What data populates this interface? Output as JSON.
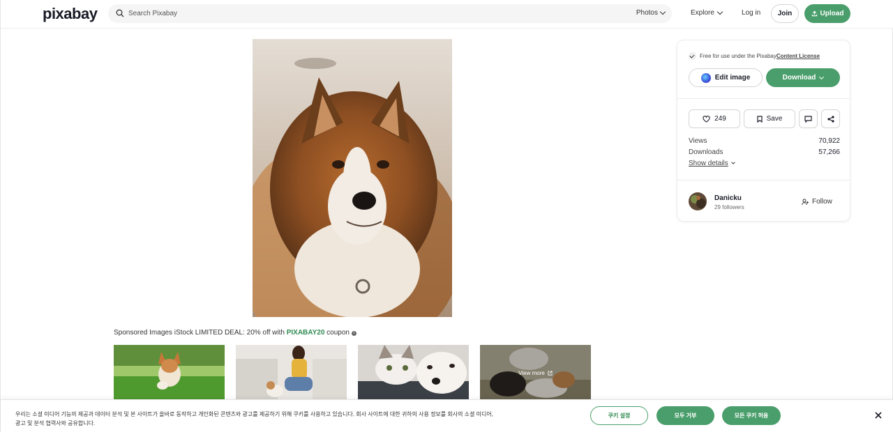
{
  "header": {
    "logo": "pixabay",
    "search_placeholder": "Search Pixabay",
    "search_type": "Photos",
    "explore": "Explore",
    "login": "Log in",
    "join": "Join",
    "upload": "Upload"
  },
  "sponsored": {
    "prefix": "Sponsored Images iStock LIMITED DEAL: 20% off with ",
    "code": "PIXABAY20",
    "suffix": " coupon",
    "view_more": "View more"
  },
  "sidebar": {
    "license_text": "Free for use under the Pixabay ",
    "license_link": "Content License",
    "edit_image": "Edit image",
    "download": "Download",
    "likes": "249",
    "save": "Save",
    "views_label": "Views",
    "views_value": "70,922",
    "downloads_label": "Downloads",
    "downloads_value": "57,266",
    "show_details": "Show details",
    "author_name": "Danicku",
    "author_followers": "29 followers",
    "follow": "Follow"
  },
  "cookie": {
    "text": "우리는 소셜 미디어 기능의 제공과 데이터 분석 및 본 사이트가 올바로 동작하고 개인화된 콘텐츠와 광고를 제공하기 위해 쿠키를 사용하고 있습니다. 회사 사이트에 대한 귀하의 사용 정보를 회사의 소셜 미디어, 광고 및 분석 협력사와 공유합니다.",
    "settings": "쿠키 설정",
    "reject": "모두 거부",
    "accept": "모든 쿠키 허용"
  },
  "colors": {
    "accent": "#4a9e6b",
    "accent_text": "#2f8a52"
  }
}
